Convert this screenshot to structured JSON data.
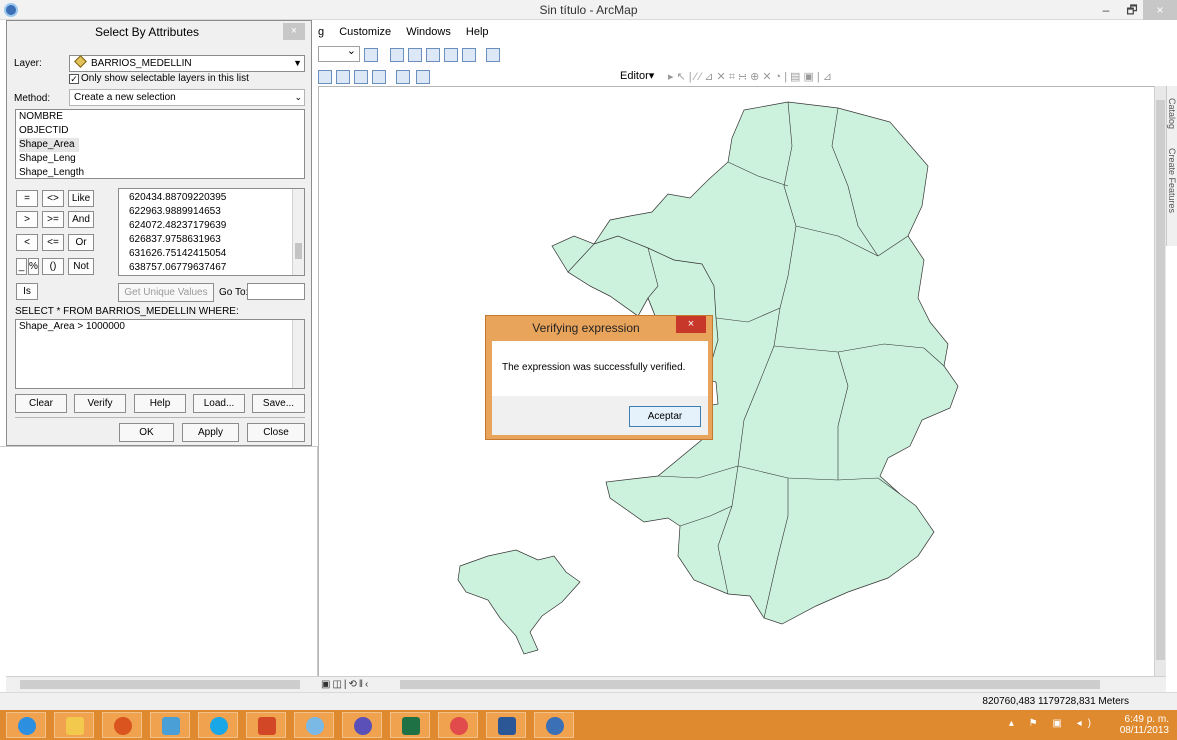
{
  "window": {
    "title": "Sin título - ArcMap",
    "minimize": "–",
    "restore": "🗗",
    "close": "×"
  },
  "menu": [
    "g",
    "Customize",
    "Windows",
    "Help"
  ],
  "editor": {
    "label": "Editor▾"
  },
  "select_by_attributes": {
    "title": "Select By Attributes",
    "close": "×",
    "layer_label": "Layer:",
    "layer_value": "BARRIOS_MEDELLIN",
    "only_selectable_label": "Only show selectable layers in this list",
    "only_selectable_checked": true,
    "method_label": "Method:",
    "method_value": "Create a new selection",
    "fields": [
      "NOMBRE",
      "OBJECTID",
      "Shape_Area",
      "Shape_Leng",
      "Shape_Length"
    ],
    "selected_field": "Shape_Area",
    "operators": [
      [
        "=",
        "<>",
        "Like"
      ],
      [
        ">",
        ">=",
        "And"
      ],
      [
        "<",
        "<=",
        "Or"
      ],
      [
        "_",
        "%",
        "()",
        "Not"
      ]
    ],
    "is_button": "Is",
    "values": [
      "620434.88709220395",
      "622963.9889914653",
      "624072.48237179639",
      "626837.9758631963",
      "631626.75142415054",
      "638757.06779637467"
    ],
    "unique_values_button": "Get Unique Values",
    "goto_label": "Go To:",
    "sql_prefix": "SELECT * FROM BARRIOS_MEDELLIN WHERE:",
    "expression": "Shape_Area > 1000000",
    "buttons": {
      "clear": "Clear",
      "verify": "Verify",
      "help": "Help",
      "load": "Load...",
      "save": "Save...",
      "ok": "OK",
      "apply": "Apply",
      "close": "Close"
    }
  },
  "verify_dialog": {
    "title": "Verifying expression",
    "close": "×",
    "message": "The expression was successfully verified.",
    "ok": "Aceptar"
  },
  "right_dock": [
    "Catalog",
    "Create Features"
  ],
  "status": {
    "coords": "820760,483 1179728,831 Meters"
  },
  "tray": {
    "time": "6:49 p. m.",
    "date": "08/11/2013"
  },
  "colors": {
    "map_fill": "#ccf2dd",
    "taskbar": "#e08a2f",
    "dialog_accent": "#e9a45c"
  }
}
